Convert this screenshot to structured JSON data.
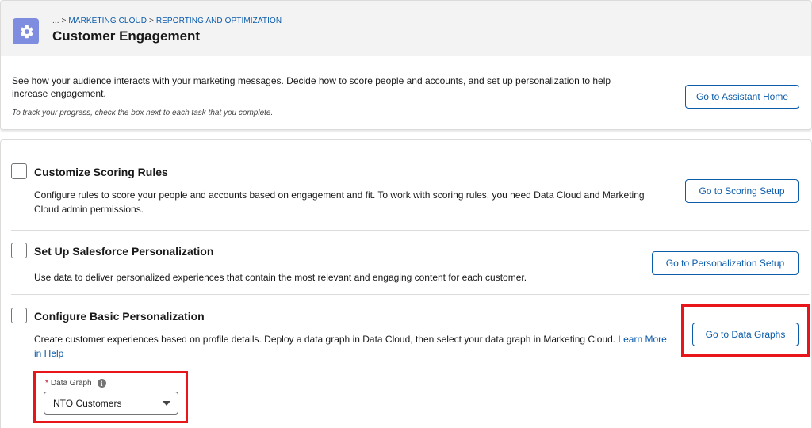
{
  "header": {
    "breadcrumb": {
      "ellipsis": "...",
      "separator": ">",
      "items": [
        "MARKETING CLOUD",
        "REPORTING AND OPTIMIZATION"
      ]
    },
    "title": "Customer Engagement",
    "icon": "gear-icon",
    "icon_color": "#7f8de1"
  },
  "intro": {
    "description": "See how your audience interacts with your marketing messages. Decide how to score people and accounts, and set up personalization to help increase engagement.",
    "note": "To track your progress, check the box next to each task that you complete.",
    "button_label": "Go to Assistant Home"
  },
  "tasks": [
    {
      "title": "Customize Scoring Rules",
      "description": "Configure rules to score your people and accounts based on engagement and fit. To work with scoring rules, you need Data Cloud and Marketing Cloud admin permissions.",
      "button_label": "Go to Scoring Setup",
      "checked": false
    },
    {
      "title": "Set Up Salesforce Personalization",
      "description": "Use data to deliver personalized experiences that contain the most relevant and engaging content for each customer.",
      "button_label": "Go to Personalization Setup",
      "checked": false
    },
    {
      "title": "Configure Basic Personalization",
      "description": "Create customer experiences based on profile details. Deploy a data graph in Data Cloud, then select your data graph in Marketing Cloud.",
      "link": "Learn More in Help",
      "button_label": "Go to Data Graphs",
      "checked": false,
      "field": {
        "required_marker": "*",
        "label": "Data Graph",
        "info_icon": "i",
        "value": "NTO Customers"
      }
    }
  ],
  "colors": {
    "accent": "#0b5cab",
    "highlight": "#e8151b"
  }
}
